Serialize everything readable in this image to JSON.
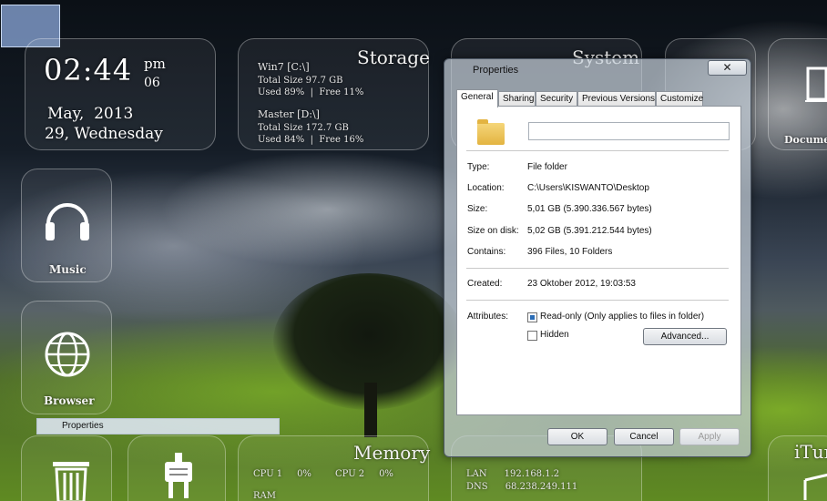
{
  "clock": {
    "time": "02:44",
    "ampm": "pm",
    "seconds": "06",
    "month_year": "May,  2013",
    "day_line": "29, Wednesday"
  },
  "storage": {
    "title": "Storage",
    "drive1_name": "Win7 [C:\\]",
    "drive1_size": "Total Size  97.7 GB",
    "drive1_used": "Used 89%  |  Free 11%",
    "drive2_name": "Master [D:\\]",
    "drive2_size": "Total Size  172.7 GB",
    "drive2_used": "Used 84%  |  Free 16%"
  },
  "system": {
    "title": "System"
  },
  "music": {
    "label": "Music"
  },
  "browser": {
    "label": "Browser"
  },
  "documents": {
    "label": "Docume"
  },
  "memory": {
    "title": "Memory",
    "cpu1": "CPU 1     0%",
    "cpu2": "CPU 2     0%",
    "ram": "RAM"
  },
  "network": {
    "lan": "LAN      192.168.1.2",
    "dns": "DNS      68.238.249.111"
  },
  "itunes": {
    "label": "iTur"
  },
  "context_item": {
    "label": "Properties"
  },
  "dialog": {
    "title": "Properties",
    "close": "✕",
    "tabs": [
      "General",
      "Sharing",
      "Security",
      "Previous Versions",
      "Customize"
    ],
    "type_label": "Type:",
    "type_value": "File folder",
    "location_label": "Location:",
    "location_value": "C:\\Users\\KISWANTO\\Desktop",
    "size_label": "Size:",
    "size_value": "5,01 GB (5.390.336.567 bytes)",
    "sizedisk_label": "Size on disk:",
    "sizedisk_value": "5,02 GB (5.391.212.544 bytes)",
    "contains_label": "Contains:",
    "contains_value": "396 Files, 10 Folders",
    "created_label": "Created:",
    "created_value": "23 Oktober 2012, 19:03:53",
    "attributes_label": "Attributes:",
    "readonly_label": "Read-only (Only applies to files in folder)",
    "hidden_label": "Hidden",
    "advanced": "Advanced...",
    "ok": "OK",
    "cancel": "Cancel",
    "apply": "Apply"
  }
}
